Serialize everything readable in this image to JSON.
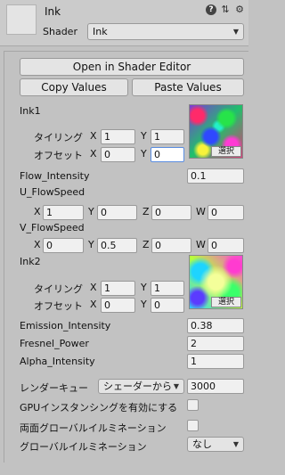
{
  "header": {
    "material_name": "Ink",
    "shader_label": "Shader",
    "shader_value": "Ink",
    "icons": [
      "help-icon",
      "preset-icon",
      "settings-gear-icon"
    ]
  },
  "buttons": {
    "open_shader_editor": "Open in Shader Editor",
    "copy_values": "Copy Values",
    "paste_values": "Paste Values"
  },
  "ink1": {
    "label": "Ink1",
    "tiling_label": "タイリング",
    "offset_label": "オフセット",
    "tiling_x": "1",
    "tiling_y": "1",
    "offset_x": "0",
    "offset_y": "0",
    "select_label": "選択"
  },
  "flow_intensity": {
    "label": "Flow_Intensity",
    "value": "0.1"
  },
  "u_flowspeed": {
    "label": "U_FlowSpeed",
    "x": "1",
    "y": "0",
    "z": "0",
    "w": "0"
  },
  "v_flowspeed": {
    "label": "V_FlowSpeed",
    "x": "0",
    "y": "0.5",
    "z": "0",
    "w": "0"
  },
  "ink2": {
    "label": "Ink2",
    "tiling_label": "タイリング",
    "offset_label": "オフセット",
    "tiling_x": "1",
    "tiling_y": "1",
    "offset_x": "0",
    "offset_y": "0",
    "select_label": "選択"
  },
  "emission_intensity": {
    "label": "Emission_Intensity",
    "value": "0.38"
  },
  "fresnel_power": {
    "label": "Fresnel_Power",
    "value": "2"
  },
  "alpha_intensity": {
    "label": "Alpha_Intensity",
    "value": "1"
  },
  "render_queue": {
    "label": "レンダーキュー",
    "mode": "シェーダーから",
    "value": "3000"
  },
  "gpu_instancing": {
    "label": "GPUインスタンシングを有効にする",
    "checked": false
  },
  "double_sided_gi": {
    "label": "両面グローバルイルミネーション",
    "checked": false
  },
  "global_illumination": {
    "label": "グローバルイルミネーション",
    "value": "なし"
  },
  "axis": {
    "x": "X",
    "y": "Y",
    "z": "Z",
    "w": "W"
  },
  "colors": {
    "background": "#c2c2c2",
    "field": "#f0f0f0",
    "focus": "#5a8de0"
  }
}
